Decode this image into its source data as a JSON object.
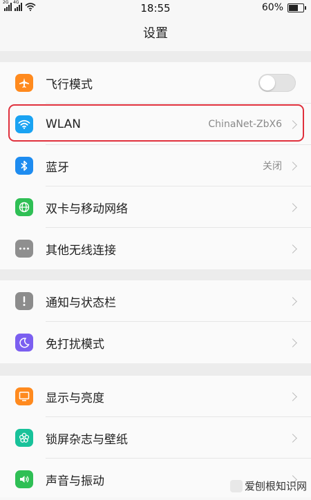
{
  "status_bar": {
    "sim1_label": "2G",
    "sim2_label": "4G",
    "time": "18:55",
    "battery_text": "60%",
    "battery_level": 0.6
  },
  "header": {
    "title": "设置"
  },
  "groups": [
    {
      "items": [
        {
          "label": "飞行模式",
          "icon": "airplane-icon",
          "color": "#ff8a1e",
          "toggle": false
        },
        {
          "label": "WLAN",
          "value": "ChinaNet-ZbX6",
          "icon": "wifi-icon",
          "color": "#1aa3f2"
        },
        {
          "label": "蓝牙",
          "value": "关闭",
          "icon": "bluetooth-icon",
          "color": "#1e8cf0"
        },
        {
          "label": "双卡与移动网络",
          "icon": "globe-icon",
          "color": "#2fbf55"
        },
        {
          "label": "其他无线连接",
          "icon": "more-icon",
          "color": "#8f8f8f"
        }
      ]
    },
    {
      "items": [
        {
          "label": "通知与状态栏",
          "icon": "notification-icon",
          "color": "#8c8c8c"
        },
        {
          "label": "免打扰模式",
          "icon": "moon-icon",
          "color": "#7b5ff0"
        }
      ]
    },
    {
      "items": [
        {
          "label": "显示与亮度",
          "icon": "display-icon",
          "color": "#ff8a1e"
        },
        {
          "label": "锁屏杂志与壁纸",
          "icon": "flower-icon",
          "color": "#18c29a"
        },
        {
          "label": "声音与振动",
          "icon": "speaker-icon",
          "color": "#2fbf55"
        }
      ]
    }
  ],
  "watermark": {
    "text": "爱刨根知识网"
  }
}
